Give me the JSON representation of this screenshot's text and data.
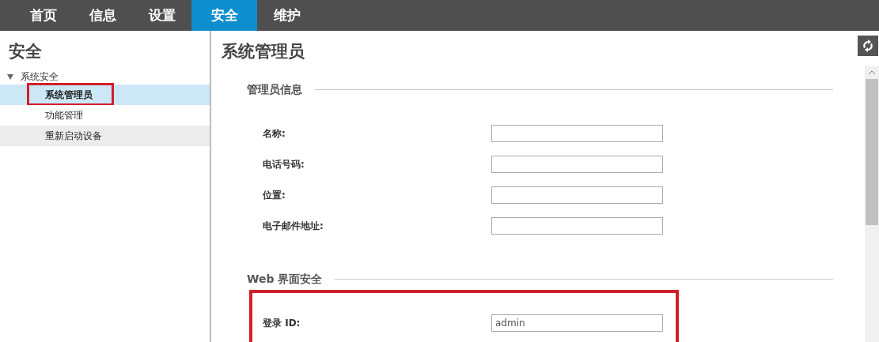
{
  "nav_tabs": [
    {
      "label": "首页",
      "selected": false
    },
    {
      "label": "信息",
      "selected": false
    },
    {
      "label": "设置",
      "selected": false
    },
    {
      "label": "安全",
      "selected": true
    },
    {
      "label": "维护",
      "selected": false
    }
  ],
  "sidebar": {
    "title": "安全",
    "tree": [
      {
        "label": "系统安全",
        "expanded": true,
        "children": [
          {
            "label": "系统管理员",
            "selected": true,
            "highlighted": true
          },
          {
            "label": "功能管理",
            "selected": false,
            "highlighted": false,
            "hovered": false
          },
          {
            "label": "重新启动设备",
            "selected": false,
            "highlighted": false,
            "hovered": true
          }
        ]
      }
    ]
  },
  "main": {
    "title": "系统管理员",
    "sections": [
      {
        "title": "管理员信息",
        "fields": [
          {
            "label": "名称:",
            "highlighted": false
          },
          {
            "label": "电话号码:",
            "highlighted": false
          },
          {
            "label": "位置:",
            "highlighted": false
          },
          {
            "label": "电子邮件地址:",
            "highlighted": false
          }
        ]
      },
      {
        "title": "Web 界面安全",
        "fields": [
          {
            "label": "登录 ID:",
            "value": "admin",
            "highlighted": true
          }
        ]
      }
    ]
  }
}
